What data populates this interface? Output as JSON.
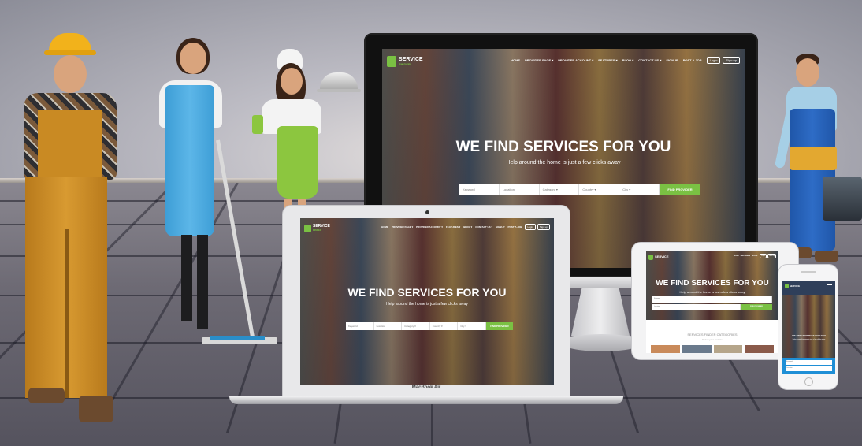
{
  "site": {
    "logo_name": "SERVICE",
    "logo_sub": "FINDER",
    "nav": [
      "HOME",
      "PROVIDER PAGE ▾",
      "PROVIDER ACCOUNT ▾",
      "FEATURES ▾",
      "BLOG ▾",
      "CONTACT US ▾",
      "SIGNUP",
      "POST A JOB"
    ],
    "login": "Login",
    "signup": "Sign up",
    "headline": "WE FIND SERVICES FOR YOU",
    "subheadline": "Help around the home is just a few clicks away",
    "search_fields": [
      "Keyword",
      "Location",
      "Category ▾",
      "Country ▾",
      "City ▾"
    ],
    "search_button": "FIND PROVIDER",
    "categories_heading": "SERVICES FINDER CATEGORIES",
    "categories_sub": "Select your Service"
  },
  "laptop_brand": "MacBook Air",
  "colors": {
    "accent": "#7ac143",
    "dark": "#111111"
  }
}
